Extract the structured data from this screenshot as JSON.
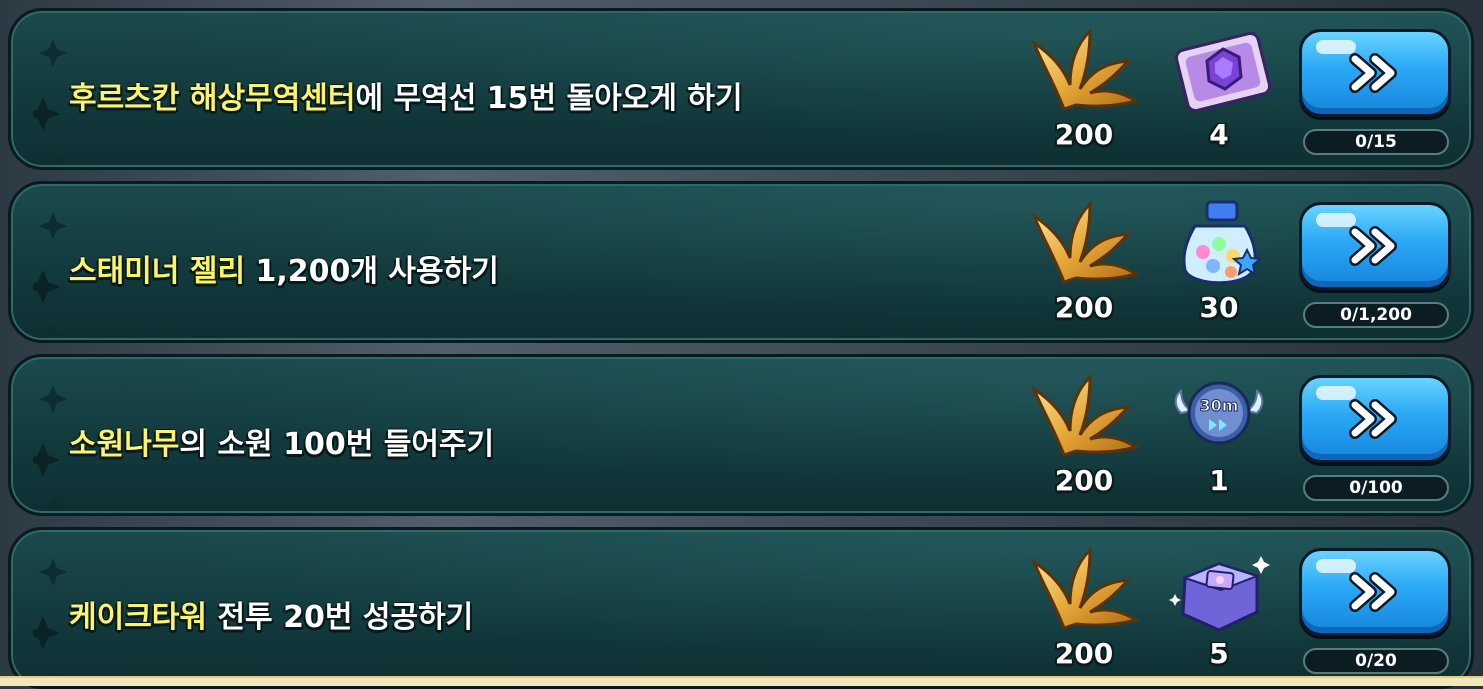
{
  "missions": [
    {
      "task_highlight": "후르츠칸 해상무역센터",
      "task_rest": "에 무역선 15번 돌아오게 하기",
      "reward1": {
        "icon": "golden-leaf-icon",
        "amount": "200"
      },
      "reward2": {
        "icon": "crystal-ticket-icon",
        "amount": "4"
      },
      "progress_text": "0/15",
      "progress_fraction": 0
    },
    {
      "task_highlight": "스태미너 젤리",
      "task_rest": " 1,200개 사용하기",
      "reward1": {
        "icon": "golden-leaf-icon",
        "amount": "200"
      },
      "reward2": {
        "icon": "jelly-jar-icon",
        "amount": "30"
      },
      "progress_text": "0/1,200",
      "progress_fraction": 0
    },
    {
      "task_highlight": "소원나무",
      "task_rest": "의 소원 100번 들어주기",
      "reward1": {
        "icon": "golden-leaf-icon",
        "amount": "200"
      },
      "reward2": {
        "icon": "time-jumper-30m-icon",
        "amount": "1"
      },
      "progress_text": "0/100",
      "progress_fraction": 0
    },
    {
      "task_highlight": "케이크타워",
      "task_rest": " 전투 20번 성공하기",
      "reward1": {
        "icon": "golden-leaf-icon",
        "amount": "200"
      },
      "reward2": {
        "icon": "purple-chest-icon",
        "amount": "5"
      },
      "progress_text": "0/20",
      "progress_fraction": 0
    }
  ],
  "texts": {
    "button_label_icon": "double-chevron-right-icon",
    "go_30m_label": "30m"
  },
  "colors": {
    "highlight": "#fff36a",
    "panel": "#123a3d",
    "button": "#2aa8f5",
    "gold": "#e6a93a"
  }
}
